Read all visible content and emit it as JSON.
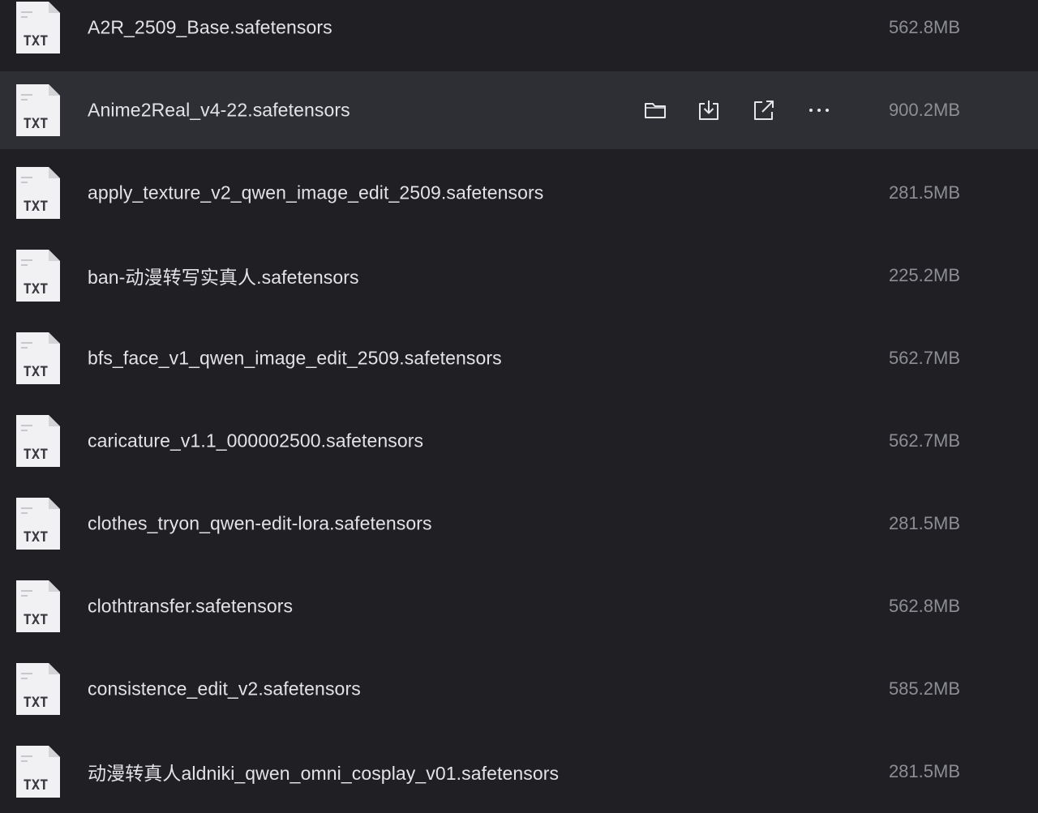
{
  "file_icon_label": "TXT",
  "row_actions": {
    "open_folder": "folder-icon",
    "download": "download-icon",
    "share": "share-icon",
    "more": "more-icon"
  },
  "colors": {
    "background": "#1f1f24",
    "hover_row": "#2e2f35",
    "file_name": "#e3e3e6",
    "file_size": "#8d8e94"
  },
  "files": [
    {
      "name": "A2R_2509_Base.safetensors",
      "size": "562.8MB"
    },
    {
      "name": "Anime2Real_v4-22.safetensors",
      "size": "900.2MB",
      "hovered": true
    },
    {
      "name": "apply_texture_v2_qwen_image_edit_2509.safetensors",
      "size": "281.5MB"
    },
    {
      "name": "ban-动漫转写实真人.safetensors",
      "size": "225.2MB"
    },
    {
      "name": "bfs_face_v1_qwen_image_edit_2509.safetensors",
      "size": "562.7MB"
    },
    {
      "name": "caricature_v1.1_000002500.safetensors",
      "size": "562.7MB"
    },
    {
      "name": "clothes_tryon_qwen-edit-lora.safetensors",
      "size": "281.5MB"
    },
    {
      "name": "clothtransfer.safetensors",
      "size": "562.8MB"
    },
    {
      "name": "consistence_edit_v2.safetensors",
      "size": "585.2MB"
    },
    {
      "name": "动漫转真人aldniki_qwen_omni_cosplay_v01.safetensors",
      "size": "281.5MB"
    }
  ]
}
